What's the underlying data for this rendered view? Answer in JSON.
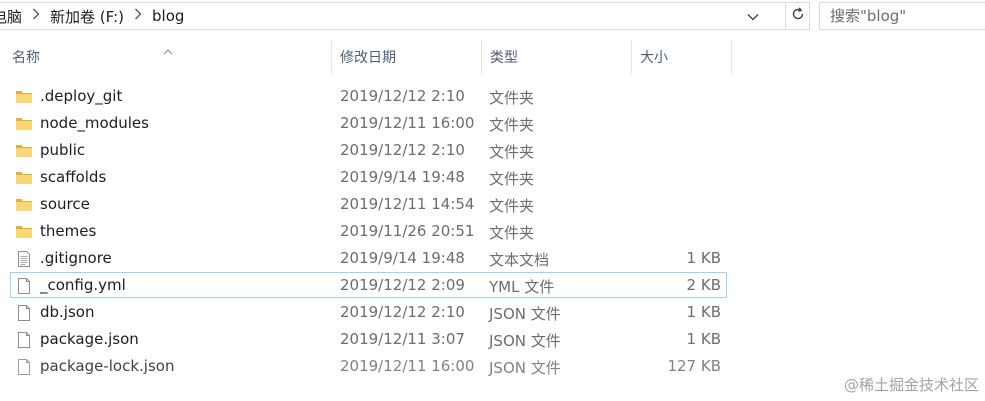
{
  "address": {
    "crumbs": [
      "电脑",
      "新加卷 (F:)",
      "blog"
    ],
    "search_placeholder": "搜索\"blog\""
  },
  "columns": {
    "name": "名称",
    "date": "修改日期",
    "type": "类型",
    "size": "大小"
  },
  "files": [
    {
      "name": ".deploy_git",
      "date": "2019/12/12 2:10",
      "type": "文件夹",
      "size": "",
      "icon": "folder-icon"
    },
    {
      "name": "node_modules",
      "date": "2019/12/11 16:00",
      "type": "文件夹",
      "size": "",
      "icon": "folder-icon"
    },
    {
      "name": "public",
      "date": "2019/12/12 2:10",
      "type": "文件夹",
      "size": "",
      "icon": "folder-icon"
    },
    {
      "name": "scaffolds",
      "date": "2019/9/14 19:48",
      "type": "文件夹",
      "size": "",
      "icon": "folder-icon"
    },
    {
      "name": "source",
      "date": "2019/12/11 14:54",
      "type": "文件夹",
      "size": "",
      "icon": "folder-icon"
    },
    {
      "name": "themes",
      "date": "2019/11/26 20:51",
      "type": "文件夹",
      "size": "",
      "icon": "folder-icon"
    },
    {
      "name": ".gitignore",
      "date": "2019/9/14 19:48",
      "type": "文本文档",
      "size": "1 KB",
      "icon": "text-document-icon"
    },
    {
      "name": "_config.yml",
      "date": "2019/12/12 2:09",
      "type": "YML 文件",
      "size": "2 KB",
      "icon": "file-icon"
    },
    {
      "name": "db.json",
      "date": "2019/12/12 2:10",
      "type": "JSON 文件",
      "size": "1 KB",
      "icon": "file-icon"
    },
    {
      "name": "package.json",
      "date": "2019/12/11 3:07",
      "type": "JSON 文件",
      "size": "1 KB",
      "icon": "file-icon"
    },
    {
      "name": "package-lock.json",
      "date": "2019/12/11 16:00",
      "type": "JSON 文件",
      "size": "127 KB",
      "icon": "file-icon"
    }
  ],
  "focused_index": 7,
  "watermark": "@稀土掘金技术社区",
  "colors": {
    "folder": "#f8d775",
    "folder_dark": "#e0b13a",
    "focus_border": "#99d1ff",
    "header_text": "#4c607a"
  }
}
